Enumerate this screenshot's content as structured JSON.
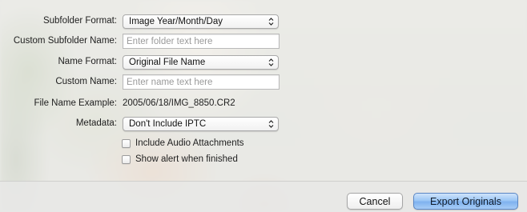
{
  "form": {
    "subfolder_format": {
      "label": "Subfolder Format:",
      "value": "Image Year/Month/Day"
    },
    "custom_subfolder_name": {
      "label": "Custom Subfolder Name:",
      "value": "",
      "placeholder": "Enter folder text here"
    },
    "name_format": {
      "label": "Name Format:",
      "value": "Original File Name"
    },
    "custom_name": {
      "label": "Custom Name:",
      "value": "",
      "placeholder": "Enter name text here"
    },
    "file_name_example": {
      "label": "File Name Example:",
      "value": "2005/06/18/IMG_8850.CR2"
    },
    "metadata": {
      "label": "Metadata:",
      "value": "Don't Include IPTC"
    },
    "include_audio": {
      "label": "Include Audio Attachments",
      "checked": false
    },
    "show_alert": {
      "label": "Show alert when finished",
      "checked": false
    }
  },
  "buttons": {
    "cancel_label": "Cancel",
    "export_label": "Export Originals"
  },
  "icons": {
    "popup_arrows": "up-down-chevron-icon"
  },
  "colors": {
    "default_button": "#7fb2ef"
  }
}
